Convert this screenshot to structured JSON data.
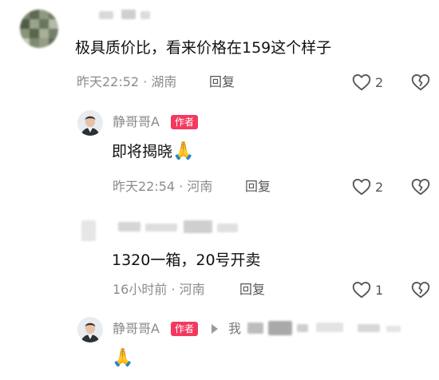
{
  "comments": [
    {
      "text": "极具质价比，看来价格在159这个样子",
      "time": "昨天22:52",
      "location": "湖南",
      "reply_label": "回复",
      "likes": "2"
    },
    {
      "author": "静哥哥A",
      "badge": "作者",
      "text": "即将揭晓",
      "emoji": "🙏",
      "time": "昨天22:54",
      "location": "河南",
      "reply_label": "回复",
      "likes": "2"
    },
    {
      "text": "1320一箱，20号开卖",
      "time": "16小时前",
      "location": "河南",
      "reply_label": "回复",
      "likes": "1"
    },
    {
      "author": "静哥哥A",
      "badge": "作者",
      "reply_prefix": "我",
      "emoji": "🙏"
    }
  ],
  "separator": "·",
  "colors": {
    "badge": "#f4395e",
    "meta": "#8c8c8c",
    "text": "#111111"
  }
}
